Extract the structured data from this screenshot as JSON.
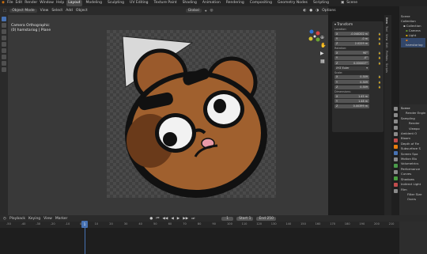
{
  "topbar": {
    "menus": [
      "File",
      "Edit",
      "Render",
      "Window",
      "Help"
    ],
    "workspaces": [
      "Layout",
      "Modeling",
      "Sculpting",
      "UV Editing",
      "Texture Paint",
      "Shading",
      "Animation",
      "Rendering",
      "Compositing",
      "Geometry Nodes",
      "Scripting"
    ],
    "scene_label": "Scene"
  },
  "header": {
    "mode": "Object Mode",
    "menus": [
      "View",
      "Select",
      "Add",
      "Object"
    ],
    "transform": "Global",
    "options": "Options"
  },
  "viewport_info": {
    "line1": "Camera Orthographic",
    "line2": "(0) hamstariog | Plane"
  },
  "npanel": {
    "title": "Transform",
    "location_label": "Location:",
    "location": [
      {
        "axis": "X",
        "value": "-0.040202 m"
      },
      {
        "axis": "Y",
        "value": "-0 m"
      },
      {
        "axis": "Z",
        "value": "2.0229 m"
      }
    ],
    "rotation_label": "Rotation:",
    "rotation": [
      {
        "axis": "X",
        "value": "90°"
      },
      {
        "axis": "Y",
        "value": "-0°"
      },
      {
        "axis": "Z",
        "value": "0.000037°"
      }
    ],
    "rotation_mode": "XYZ Euler",
    "scale_label": "Scale:",
    "scale": [
      {
        "axis": "X",
        "value": "0.309"
      },
      {
        "axis": "Y",
        "value": "0.309"
      },
      {
        "axis": "Z",
        "value": "0.309"
      }
    ],
    "dimensions_label": "Dimensions:",
    "dimensions": [
      {
        "axis": "X",
        "value": "1.45 m"
      },
      {
        "axis": "Y",
        "value": "1.48 m"
      },
      {
        "axis": "Z",
        "value": "0.00399 m"
      }
    ]
  },
  "sidetabs": [
    "Item",
    "Tool",
    "View",
    "Edit",
    "Prefabs",
    "Scripts"
  ],
  "outliner": {
    "title": "Scene Collection",
    "items": [
      "Collection",
      "Camera",
      "Light",
      "hamstariog"
    ]
  },
  "properties": {
    "scene": "Scene",
    "render_engine_label": "Render Engin",
    "sampling": "Sampling",
    "items": [
      "Render",
      "Viewpo",
      "Ambient O",
      "Bloom",
      "Depth of Fie",
      "Subsurface S",
      "Screen Spa",
      "Motion Blu",
      "Volumetrics",
      "Performance",
      "Curves",
      "Shadows",
      "Indirect Light",
      "Film",
      "Filter Size",
      "Overs"
    ]
  },
  "timeline": {
    "menus": [
      "Playback",
      "Keying",
      "View",
      "Marker"
    ],
    "current_frame": "1",
    "start_label": "Start",
    "start": "1",
    "end_label": "End",
    "end": "250",
    "ruler": [
      "-50",
      "-40",
      "-30",
      "-20",
      "-10",
      "0",
      "10",
      "20",
      "30",
      "40",
      "50",
      "60",
      "70",
      "80",
      "90",
      "100",
      "110",
      "120",
      "130",
      "140",
      "150",
      "160",
      "170",
      "180",
      "190",
      "200",
      "210"
    ],
    "cursor": "1"
  }
}
